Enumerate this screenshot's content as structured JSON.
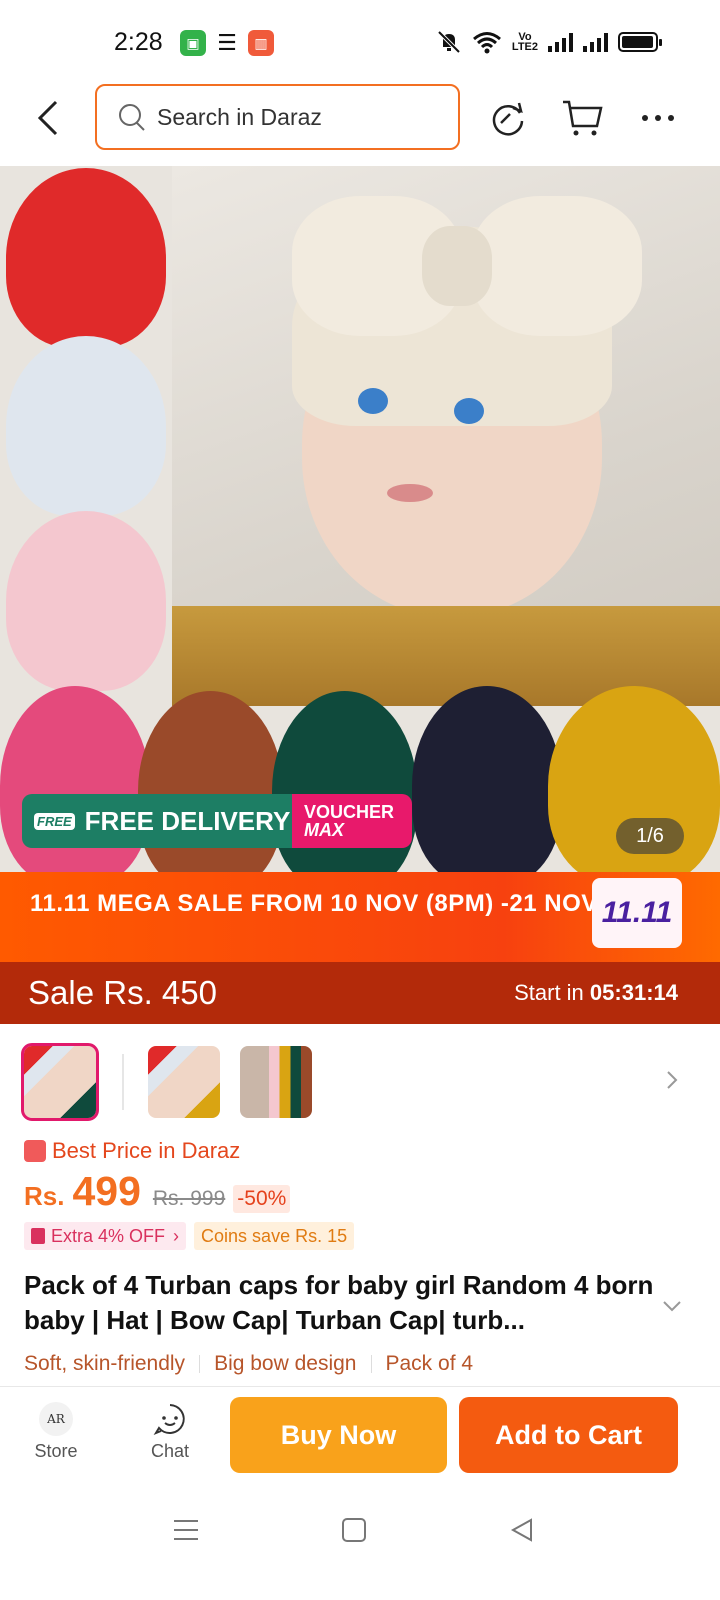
{
  "status_bar": {
    "time": "2:28",
    "volte": "VoLTE2"
  },
  "search": {
    "placeholder": "Search in Daraz"
  },
  "hero": {
    "free_delivery": "FREE DELIVERY",
    "free_tag": "FREE",
    "voucher_line1": "VOUCHER",
    "voucher_line2": "MAX",
    "counter": "1/6"
  },
  "mega_sale": {
    "text": "11.11 MEGA SALE FROM 10 NOV (8PM) -21 NOV",
    "logo": "11.11"
  },
  "flash": {
    "sale_label": "Sale",
    "sale_price": "Rs. 450",
    "start_label": "Start in",
    "countdown": "05:31:14"
  },
  "pricing": {
    "best_price": "Best Price in Daraz",
    "currency": "Rs.",
    "price": "499",
    "old_price": "Rs. 999",
    "discount": "-50%",
    "extra_off": "Extra 4% OFF",
    "coins": "Coins save Rs. 15"
  },
  "product": {
    "title": "Pack of 4  Turban caps for baby girl  Random 4 born baby | Hat | Bow Cap| Turban Cap| turb...",
    "features": [
      "Soft, skin-friendly",
      "Big bow design",
      "Pack of 4"
    ]
  },
  "action_bar": {
    "store_label": "Store",
    "store_logo": "AR",
    "chat_label": "Chat",
    "buy_now": "Buy Now",
    "add_to_cart": "Add to Cart"
  },
  "colors": {
    "accent_orange": "#f36f21",
    "buy_now": "#f9a21b",
    "add_to_cart": "#f45b10",
    "flash_bg": "#b32a0a"
  }
}
